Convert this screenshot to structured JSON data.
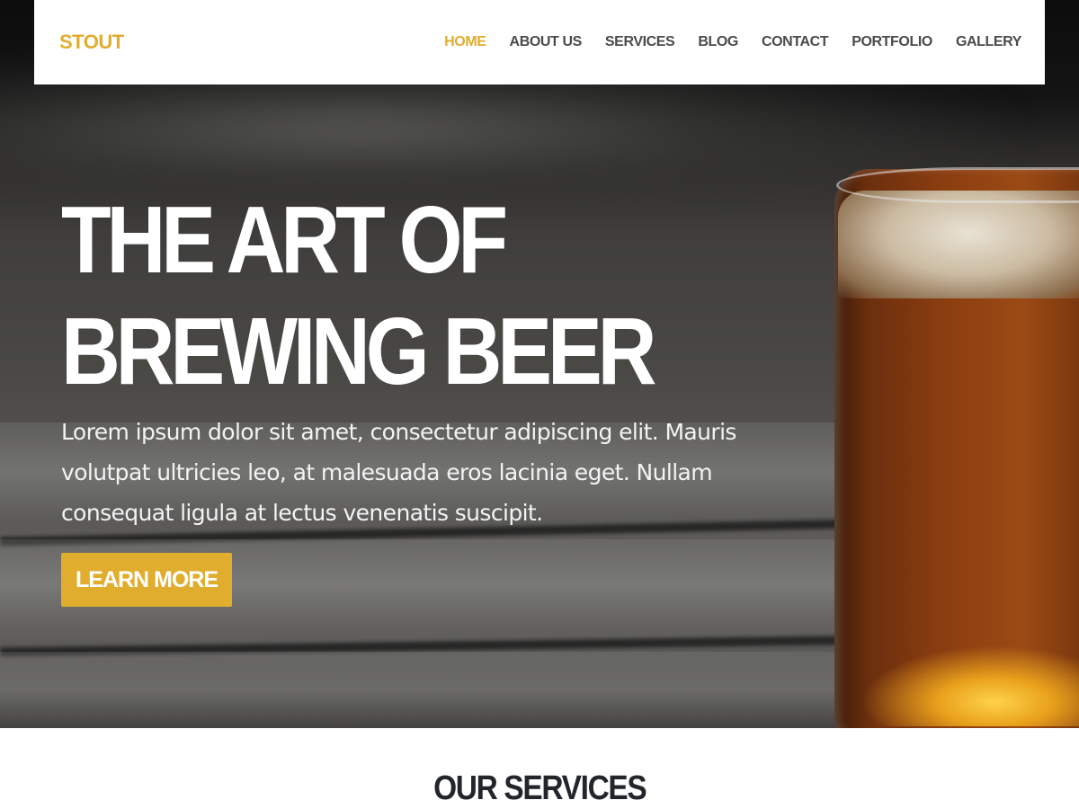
{
  "navbar": {
    "brand": "STOUT",
    "links": [
      {
        "label": "HOME",
        "active": true
      },
      {
        "label": "ABOUT US",
        "active": false
      },
      {
        "label": "SERVICES",
        "active": false
      },
      {
        "label": "BLOG",
        "active": false
      },
      {
        "label": "CONTACT",
        "active": false
      },
      {
        "label": "PORTFOLIO",
        "active": false
      },
      {
        "label": "GALLERY",
        "active": false
      }
    ]
  },
  "hero": {
    "title_line1": "THE ART OF",
    "title_line2": "BREWING BEER",
    "text": "Lorem ipsum dolor sit amet, consectetur adipiscing elit. Mauris volutpat ultricies leo, at malesuada eros lacinia eget. Nullam consequat ligula at lectus venenatis suscipit.",
    "button_label": "LEARN MORE",
    "background_image": "beer-glass-on-wooden-table"
  },
  "services": {
    "title": "OUR SERVICES"
  },
  "colors": {
    "accent": "#e1ad2e",
    "nav_text": "#4b4b4b",
    "heading_dark": "#22262b"
  }
}
